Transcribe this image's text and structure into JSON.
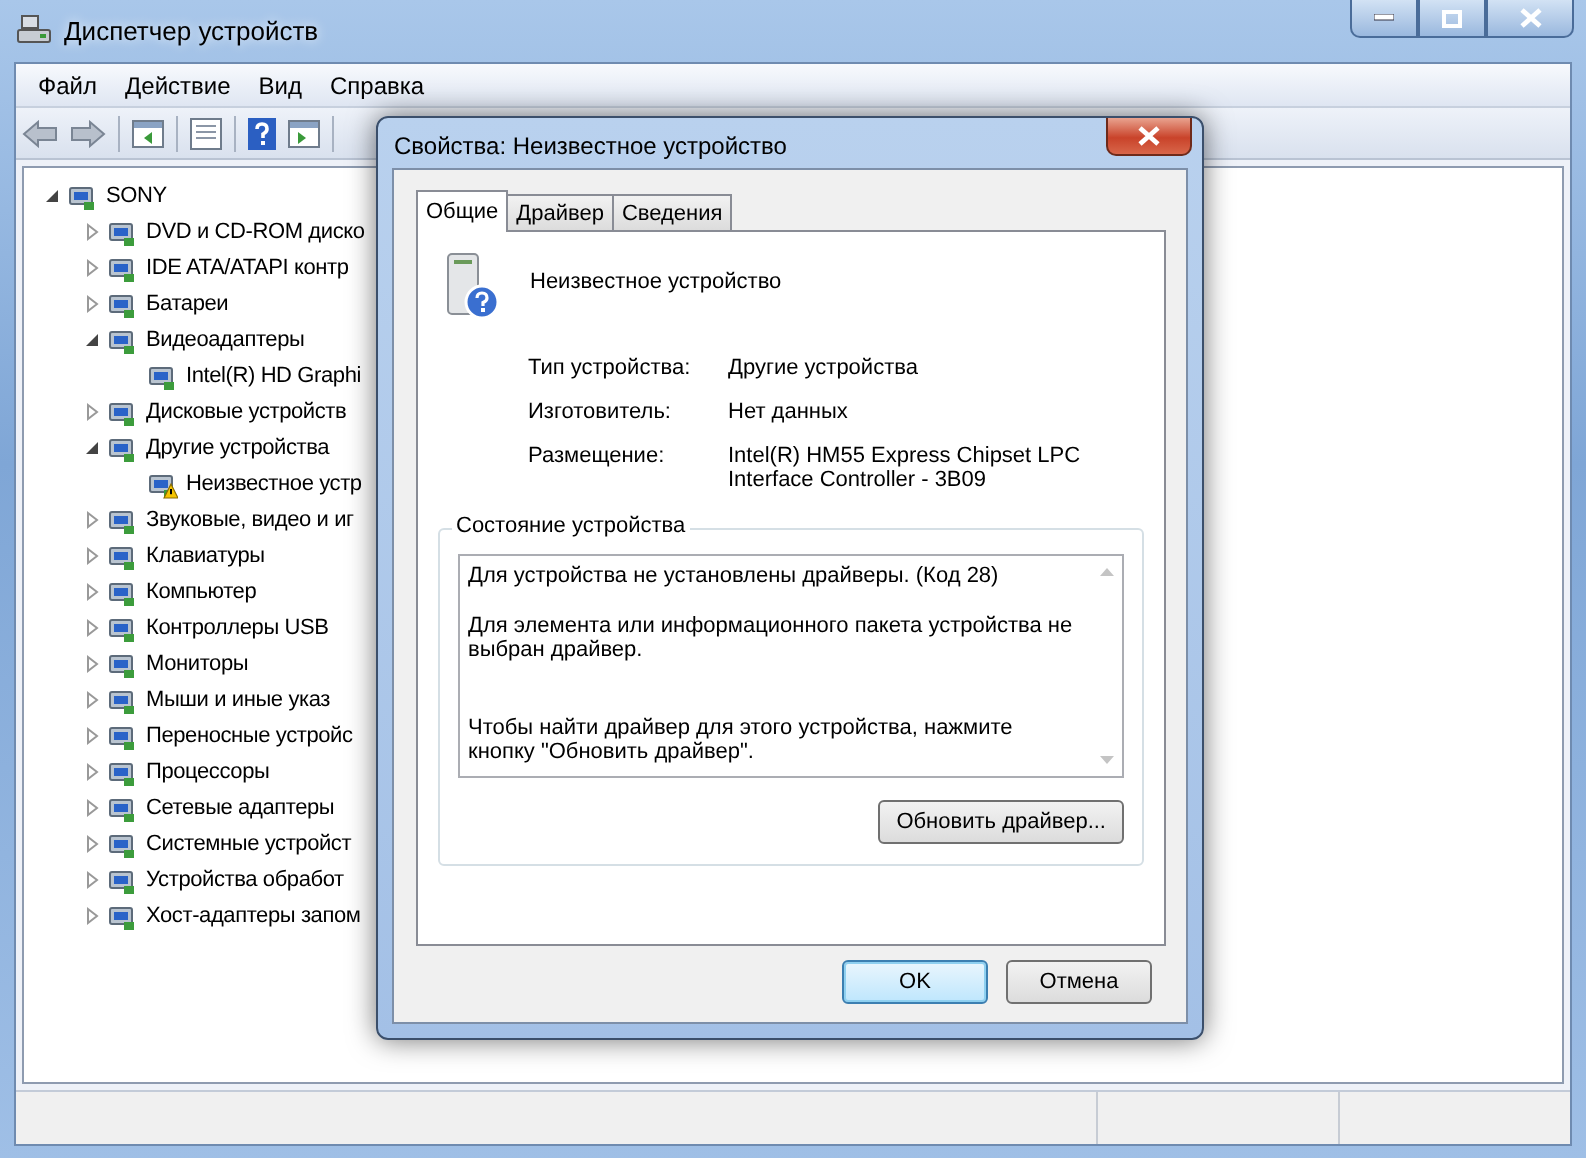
{
  "window": {
    "title": "Диспетчер устройств"
  },
  "menu": [
    "Файл",
    "Действие",
    "Вид",
    "Справка"
  ],
  "tree": [
    {
      "label": "SONY",
      "expanded": true,
      "warning": false,
      "children": [
        {
          "label": "DVD и CD-ROM диско",
          "expanded": false,
          "warning": false
        },
        {
          "label": "IDE ATA/ATAPI контр",
          "expanded": false,
          "warning": false
        },
        {
          "label": "Батареи",
          "expanded": false,
          "warning": false
        },
        {
          "label": "Видеоадаптеры",
          "expanded": true,
          "warning": false,
          "children": [
            {
              "label": "Intel(R) HD Graphi",
              "warning": false
            }
          ]
        },
        {
          "label": "Дисковые устройств",
          "expanded": false,
          "warning": false
        },
        {
          "label": "Другие устройства",
          "expanded": true,
          "warning": false,
          "children": [
            {
              "label": "Неизвестное устр",
              "warning": true
            }
          ]
        },
        {
          "label": "Звуковые, видео и иг",
          "expanded": false,
          "warning": false
        },
        {
          "label": "Клавиатуры",
          "expanded": false,
          "warning": false
        },
        {
          "label": "Компьютер",
          "expanded": false,
          "warning": false
        },
        {
          "label": "Контроллеры USB",
          "expanded": false,
          "warning": false
        },
        {
          "label": "Мониторы",
          "expanded": false,
          "warning": false
        },
        {
          "label": "Мыши и иные указ",
          "expanded": false,
          "warning": false
        },
        {
          "label": "Переносные устройс",
          "expanded": false,
          "warning": false
        },
        {
          "label": "Процессоры",
          "expanded": false,
          "warning": false
        },
        {
          "label": "Сетевые адаптеры",
          "expanded": false,
          "warning": false
        },
        {
          "label": "Системные устройст",
          "expanded": false,
          "warning": false
        },
        {
          "label": "Устройства обработ",
          "expanded": false,
          "warning": false
        },
        {
          "label": "Хост-адаптеры запом",
          "expanded": false,
          "warning": false
        }
      ]
    }
  ],
  "dialog": {
    "title": "Свойства: Неизвестное устройство",
    "tabs": [
      {
        "label": "Общие",
        "selected": true
      },
      {
        "label": "Драйвер",
        "selected": false
      },
      {
        "label": "Сведения",
        "selected": false
      }
    ],
    "device_name": "Неизвестное устройство",
    "properties": [
      {
        "label": "Тип устройства:",
        "value": "Другие устройства"
      },
      {
        "label": "Изготовитель:",
        "value": "Нет данных"
      },
      {
        "label": "Размещение:",
        "value": "Intel(R) HM55 Express Chipset LPC Interface Controller - 3B09"
      }
    ],
    "status": {
      "title": "Состояние устройства",
      "paragraphs": [
        "Для устройства не установлены драйверы. (Код 28)",
        "Для элемента или информационного пакета устройства не выбран драйвер.",
        "Чтобы найти драйвер для этого устройства, нажмите кнопку \"Обновить драйвер\"."
      ],
      "button": "Обновить драйвер..."
    },
    "buttons": [
      {
        "label": "OK",
        "default": true
      },
      {
        "label": "Отмена",
        "default": false
      }
    ]
  }
}
